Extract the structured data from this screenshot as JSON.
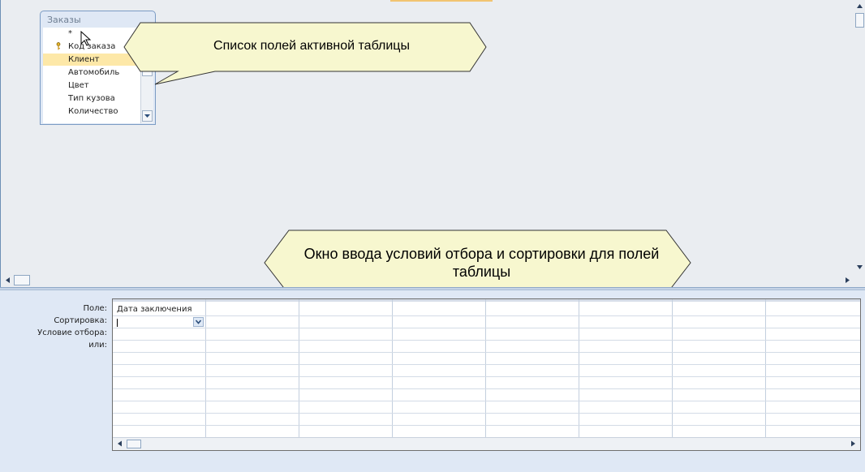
{
  "table": {
    "title": "Заказы",
    "fields": [
      {
        "label": "*",
        "key": false,
        "selected": false
      },
      {
        "label": "Код заказа",
        "key": true,
        "selected": false
      },
      {
        "label": "Клиент",
        "key": false,
        "selected": true
      },
      {
        "label": "Автомобиль",
        "key": false,
        "selected": false
      },
      {
        "label": "Цвет",
        "key": false,
        "selected": false
      },
      {
        "label": "Тип кузова",
        "key": false,
        "selected": false
      },
      {
        "label": "Количество",
        "key": false,
        "selected": false
      }
    ]
  },
  "callouts": {
    "field_list": "Список полей активной таблицы",
    "criteria_line1": "Окно ввода условий отбора и сортировки для полей",
    "criteria_line2": "таблицы"
  },
  "grid": {
    "row_labels": {
      "field": "Поле:",
      "sort": "Сортировка:",
      "criteria": "Условие отбора:",
      "or": "или:"
    },
    "first_column_field": "Дата заключения",
    "columns": 8
  },
  "colors": {
    "background": "#eaedf1",
    "selection": "#fde8a8",
    "callout_fill": "#f7f7cf",
    "lower_pane": "#dfe8f5"
  },
  "icons": [
    "key-icon",
    "mouse-pointer-icon",
    "scroll-arrow-icons"
  ]
}
